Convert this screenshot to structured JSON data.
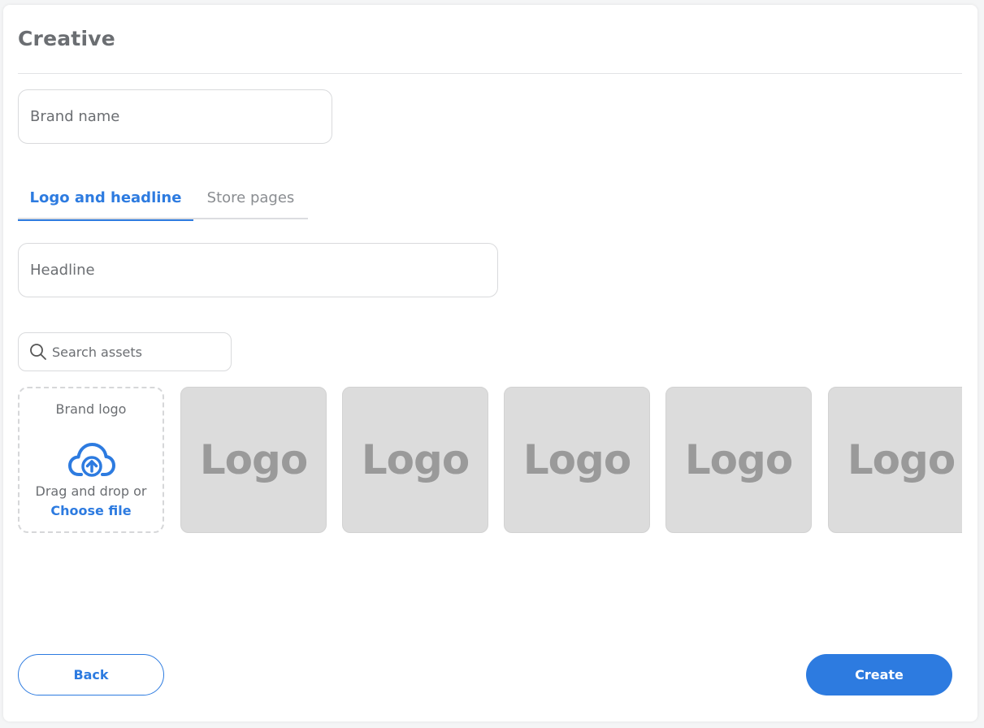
{
  "section": {
    "title": "Creative"
  },
  "fields": {
    "brand_name_placeholder": "Brand name",
    "headline_placeholder": "Headline"
  },
  "tabs": [
    {
      "label": "Logo and headline",
      "active": true
    },
    {
      "label": "Store pages",
      "active": false
    }
  ],
  "search": {
    "placeholder": "Search assets",
    "icon": "search-icon"
  },
  "upload": {
    "title": "Brand logo",
    "icon": "cloud-upload-icon",
    "drag_text": "Drag and drop or",
    "choose_label": "Choose file"
  },
  "logos": [
    "Logo",
    "Logo",
    "Logo",
    "Logo",
    "Logo"
  ],
  "buttons": {
    "back": "Back",
    "create": "Create"
  },
  "colors": {
    "accent": "#2d7be0",
    "logo_placeholder_bg": "#dcdcdc"
  }
}
